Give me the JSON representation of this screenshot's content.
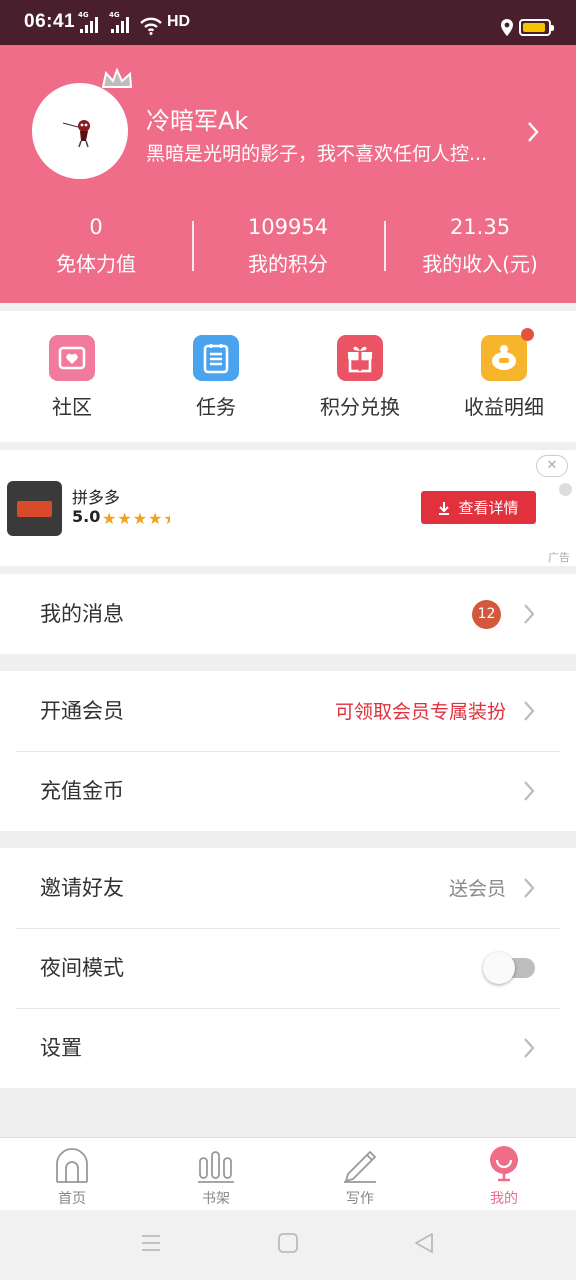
{
  "status_bar": {
    "time": "06:41",
    "network_1": "4G",
    "network_2": "4G",
    "hd": "HD",
    "battery_level": 0.9,
    "battery_color": "#f5c400"
  },
  "profile": {
    "username": "冷暗军Ak",
    "signature": "黑暗是光明的影子，我不喜欢任何人控...",
    "header_color": "#ef6d88",
    "stats": [
      {
        "value": "0",
        "label": "免体力值"
      },
      {
        "value": "109954",
        "label": "我的积分"
      },
      {
        "value": "21.35",
        "label": "我的收入(元)"
      }
    ]
  },
  "quick_menu": [
    {
      "label": "社区",
      "icon": "community-icon",
      "color": "#f27a9c"
    },
    {
      "label": "任务",
      "icon": "task-list-icon",
      "color": "#4aa3ef"
    },
    {
      "label": "积分兑换",
      "icon": "gift-icon",
      "color": "#ea5464"
    },
    {
      "label": "收益明细",
      "icon": "piggy-bank-icon",
      "color": "#f6b52a",
      "has_dot": true
    }
  ],
  "ad": {
    "app_name": "拼多多",
    "rating": "5.0",
    "stars": 4.5,
    "button_label": "查看详情",
    "ad_label": "广告",
    "close_icon": "close-icon"
  },
  "list": {
    "messages": {
      "label": "我的消息",
      "badge": "12"
    },
    "vip": {
      "label": "开通会员",
      "value": "可领取会员专属装扮",
      "value_color": "#e1313d"
    },
    "coins": {
      "label": "充值金币"
    },
    "invite": {
      "label": "邀请好友",
      "value": "送会员"
    },
    "night_mode": {
      "label": "夜间模式",
      "enabled": false
    },
    "settings": {
      "label": "设置"
    }
  },
  "tabbar": [
    {
      "label": "首页",
      "icon": "home-icon",
      "active": false
    },
    {
      "label": "书架",
      "icon": "bookshelf-icon",
      "active": false
    },
    {
      "label": "写作",
      "icon": "pencil-icon",
      "active": false
    },
    {
      "label": "我的",
      "icon": "profile-icon",
      "active": true
    }
  ],
  "accent_color": "#ef6d88"
}
